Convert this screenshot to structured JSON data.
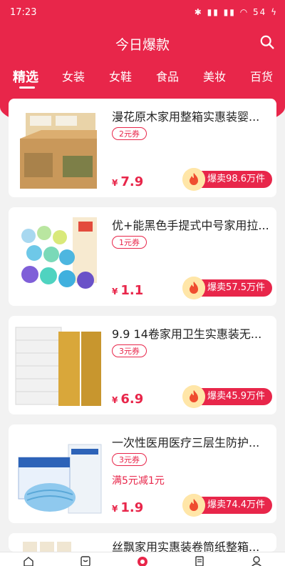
{
  "status_bar": {
    "time": "17:23",
    "battery": "54"
  },
  "header": {
    "title": "今日爆款"
  },
  "tabs": [
    {
      "label": "精选",
      "active": true
    },
    {
      "label": "女装"
    },
    {
      "label": "女鞋"
    },
    {
      "label": "食品"
    },
    {
      "label": "美妆"
    },
    {
      "label": "百货"
    }
  ],
  "products": [
    {
      "name": "漫花原木家用整箱实惠装婴...",
      "coupon": "2元券",
      "promo": "",
      "currency": "¥",
      "price": "7.9",
      "sold": "爆卖98.6万件"
    },
    {
      "name": "优+能黑色手提式中号家用拉...",
      "coupon": "1元券",
      "promo": "",
      "currency": "¥",
      "price": "1.1",
      "sold": "爆卖57.5万件"
    },
    {
      "name": "9.9 14卷家用卫生实惠装无...",
      "coupon": "3元券",
      "promo": "",
      "currency": "¥",
      "price": "6.9",
      "sold": "爆卖45.9万件"
    },
    {
      "name": "一次性医用医疗三层生防护...",
      "coupon": "3元券",
      "promo": "满5元减1元",
      "currency": "¥",
      "price": "1.9",
      "sold": "爆卖74.4万件"
    },
    {
      "name": "丝飘家用实惠装卷筒纸整箱...",
      "coupon": "",
      "promo": "",
      "currency": "",
      "price": "",
      "sold": ""
    }
  ],
  "bottom_nav": [
    {
      "icon": "home-icon"
    },
    {
      "icon": "category-icon"
    },
    {
      "icon": "hot-icon"
    },
    {
      "icon": "list-icon"
    },
    {
      "icon": "profile-icon"
    }
  ],
  "colors": {
    "brand": "#e8264a"
  }
}
